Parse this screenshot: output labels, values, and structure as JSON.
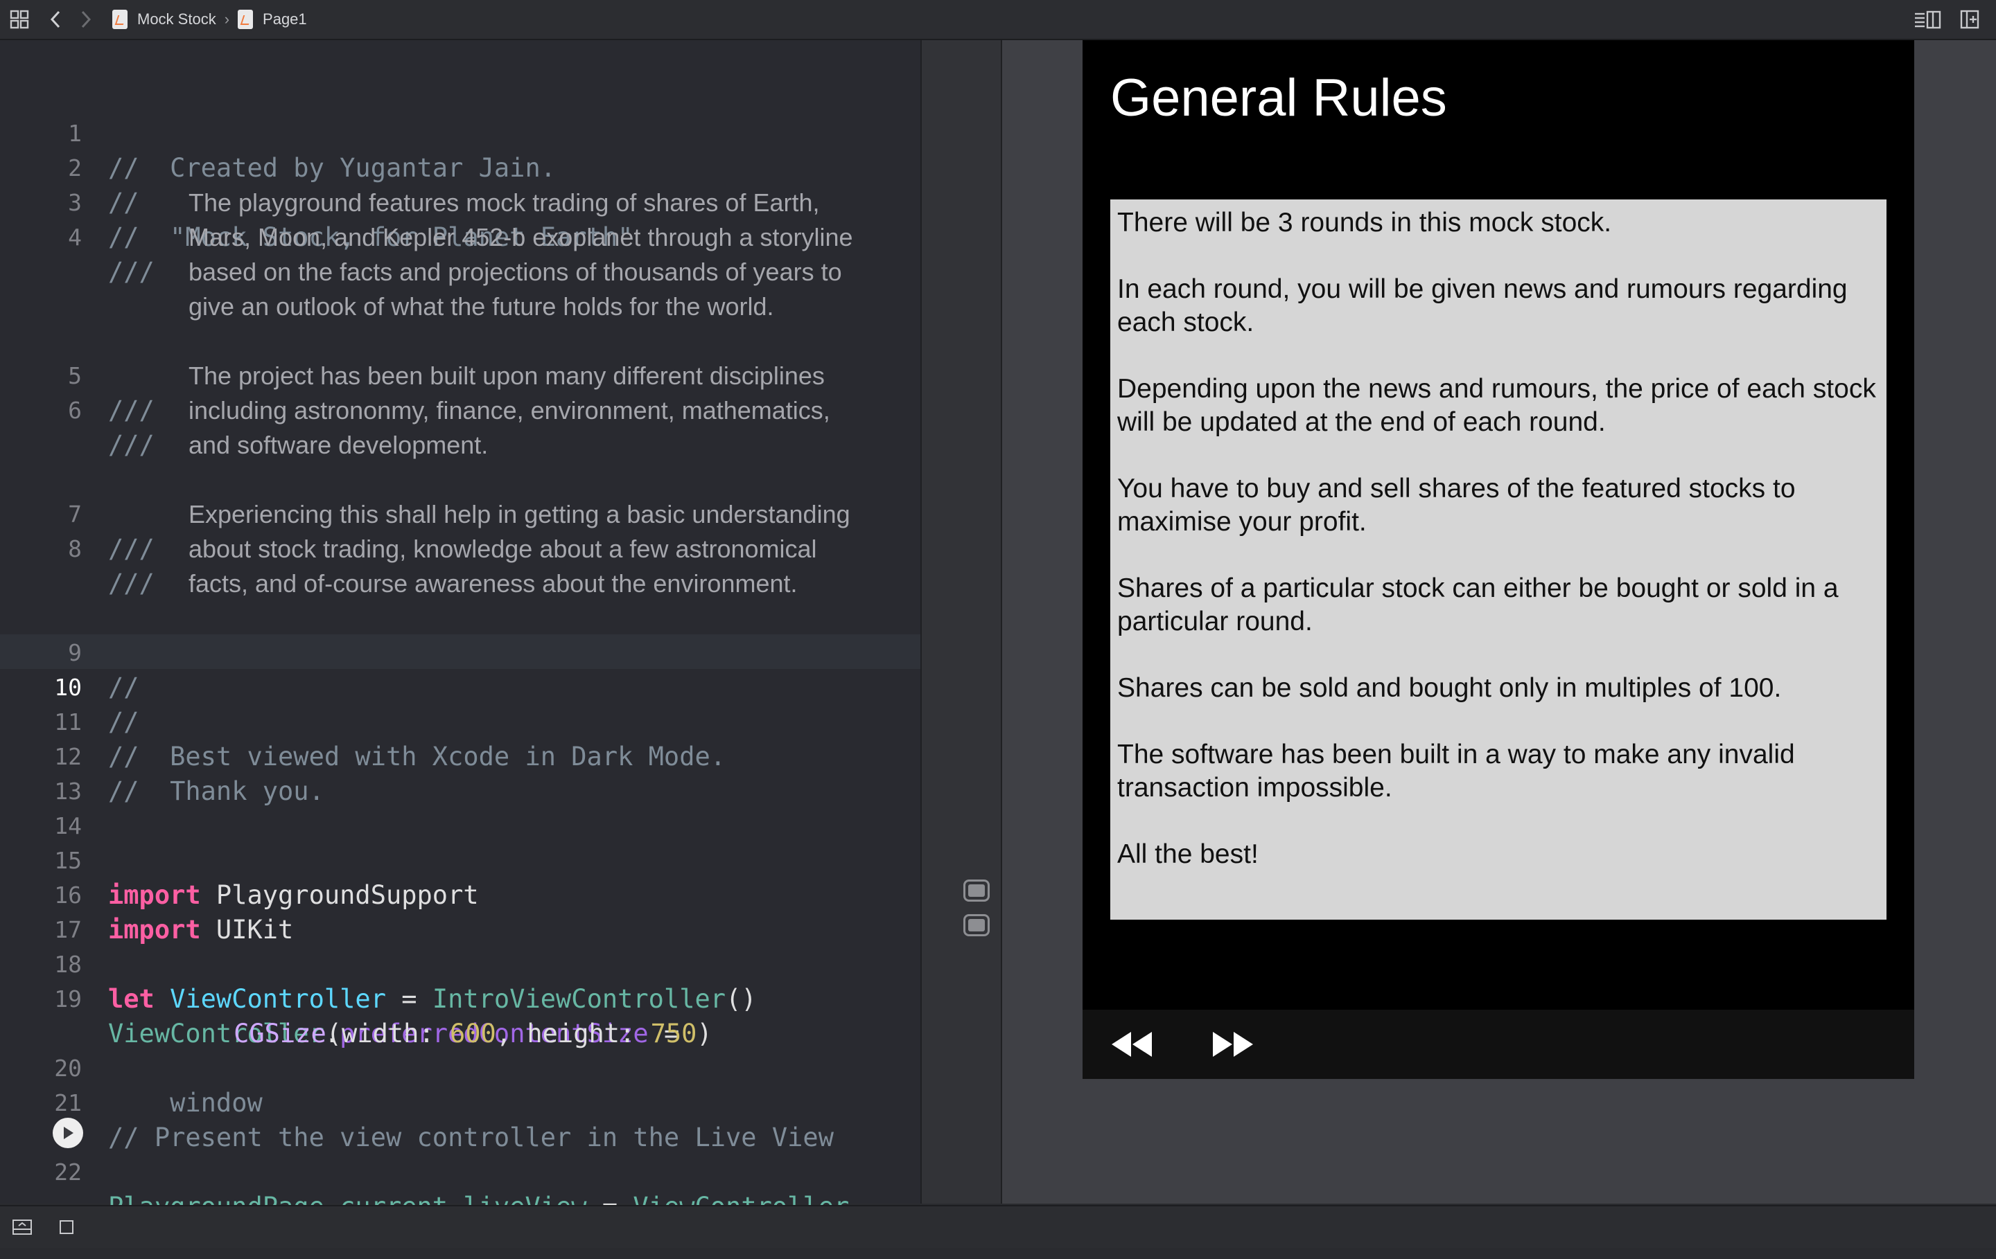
{
  "breadcrumb": {
    "project": "Mock Stock",
    "page": "Page1"
  },
  "editor": {
    "current_line": "10",
    "lines": [
      {
        "n": "1",
        "text": "//  Created by Yugantar Jain."
      },
      {
        "n": "2",
        "text": "//"
      },
      {
        "n": "3",
        "text": "//  \"Mock Stock, for Planet Earth\""
      },
      {
        "n": "4",
        "prefix": "///",
        "doc": [
          "The playground features mock trading of shares of Earth,",
          "Mars, Moon, and Kepler 452-b exoplanet through a storyline",
          "based on the facts and projections of thousands of years to",
          "give an outlook of what the future holds for the world."
        ]
      },
      {
        "n": "5",
        "text": "///"
      },
      {
        "n": "6",
        "prefix": "///",
        "doc": [
          "The project has been built upon many different disciplines",
          "including astrononmy, finance, environment, mathematics,",
          "and software development."
        ]
      },
      {
        "n": "7",
        "text": "///"
      },
      {
        "n": "8",
        "prefix": "///",
        "doc": [
          "Experiencing this shall help in getting a basic understanding",
          "about stock trading, knowledge about a few astronomical",
          "facts, and of-course awareness about the environment."
        ]
      },
      {
        "n": "9",
        "text": "//"
      },
      {
        "n": "10",
        "text": "//"
      },
      {
        "n": "11",
        "text": "//  Best viewed with Xcode in Dark Mode."
      },
      {
        "n": "12",
        "text": "//  Thank you."
      },
      {
        "n": "13",
        "text": ""
      },
      {
        "n": "14",
        "text": ""
      },
      {
        "n": "15",
        "kw": "import",
        "rest": " PlaygroundSupport"
      },
      {
        "n": "16",
        "kw": "import",
        "rest": " UIKit"
      },
      {
        "n": "17",
        "text": ""
      },
      {
        "n": "18"
      },
      {
        "n": "19"
      },
      {
        "n": "20",
        "text": ""
      },
      {
        "n": "21",
        "text": "// Present the view controller in the Live View",
        "cont": "    window"
      },
      {
        "n": "22"
      }
    ],
    "l18": {
      "kw": "let",
      "var": "ViewController",
      "eq": " = ",
      "call": "IntroViewController",
      "paren": "()"
    },
    "l19": {
      "obj": "ViewController",
      "dot": ".",
      "prop": "preferredContentSize",
      "eq": " =",
      "cont_fn": "CGSize",
      "cont_a": "(width: ",
      "w": "600",
      "cont_b": ", height: ",
      "h": "750",
      "cont_c": ")"
    },
    "l22": {
      "obj": "PlaygroundPage",
      "d1": ".",
      "p1": "current",
      "d2": ".",
      "p2": "liveView",
      "eq": " = ",
      "val": "ViewController"
    }
  },
  "live_view": {
    "title": "General Rules",
    "rules": [
      "There will be 3 rounds in this mock stock.",
      "In each round, you will be given news and rumours regarding each stock.",
      "Depending upon the news and rumours, the price of each stock will be updated at the end of each round.",
      "You have to buy and sell shares of the featured stocks to maximise your profit.",
      "Shares of a particular stock can either be bought or sold in a particular round.",
      "Shares can be sold and bought only in multiples of 100.",
      "The software has been built in a way to make any invalid transaction impossible.",
      "All the best!"
    ]
  },
  "colors": {
    "editor_bg": "#292a30",
    "keyword": "#fc5fa3",
    "type": "#5dd8ff",
    "property": "#a167e6",
    "number": "#d0bf69",
    "comment": "#7f8c98"
  },
  "icons": [
    "grid-icon",
    "back-chevron-icon",
    "forward-chevron-icon",
    "swift-file-icon",
    "inspector-toggle-icon",
    "library-icon",
    "run-icon",
    "rewind-icon",
    "fast-forward-icon",
    "debug-area-icon",
    "stop-icon"
  ]
}
